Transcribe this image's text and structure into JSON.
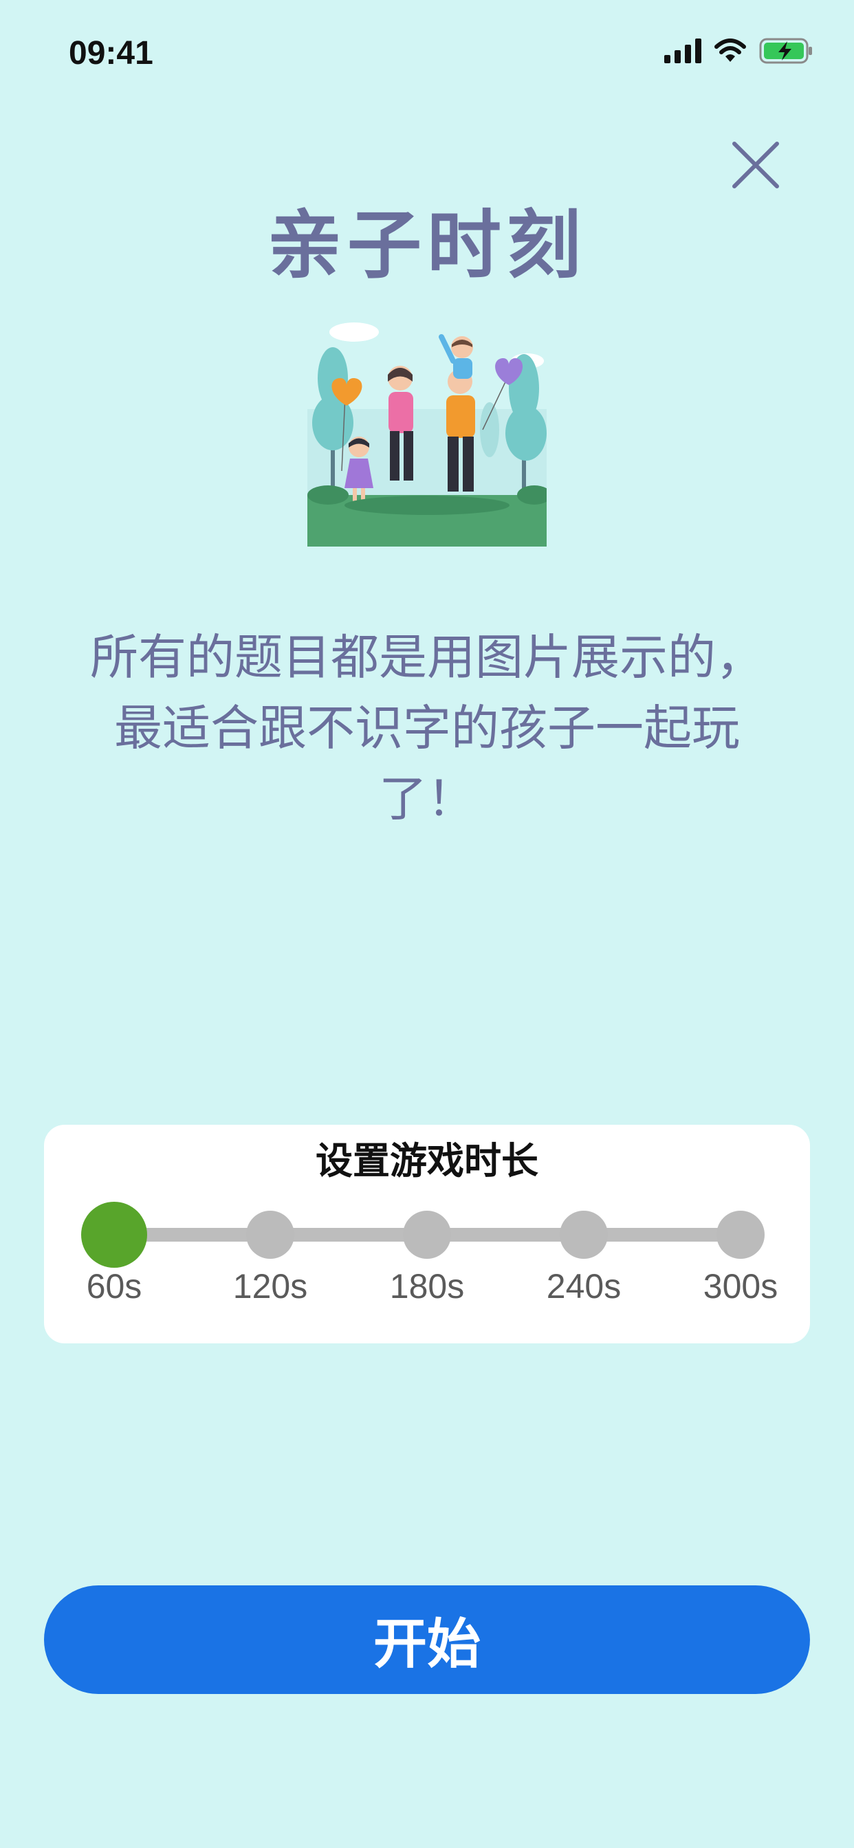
{
  "status_bar": {
    "time": "09:41"
  },
  "header": {
    "title": "亲子时刻",
    "close_icon": "close-icon"
  },
  "description": [
    "所有的题目都是用图片展示的，",
    "最适合跟不识字的孩子一起玩",
    "了！"
  ],
  "duration": {
    "title": "设置游戏时长",
    "options": [
      "60s",
      "120s",
      "180s",
      "240s",
      "300s"
    ],
    "selected": "60s",
    "active_color": "#58a52b",
    "inactive_color": "#bbbbbb"
  },
  "start_button": {
    "label": "开始",
    "color": "#1a73e5"
  },
  "colors": {
    "background": "#d2f5f4",
    "title": "#6a6f9c"
  }
}
